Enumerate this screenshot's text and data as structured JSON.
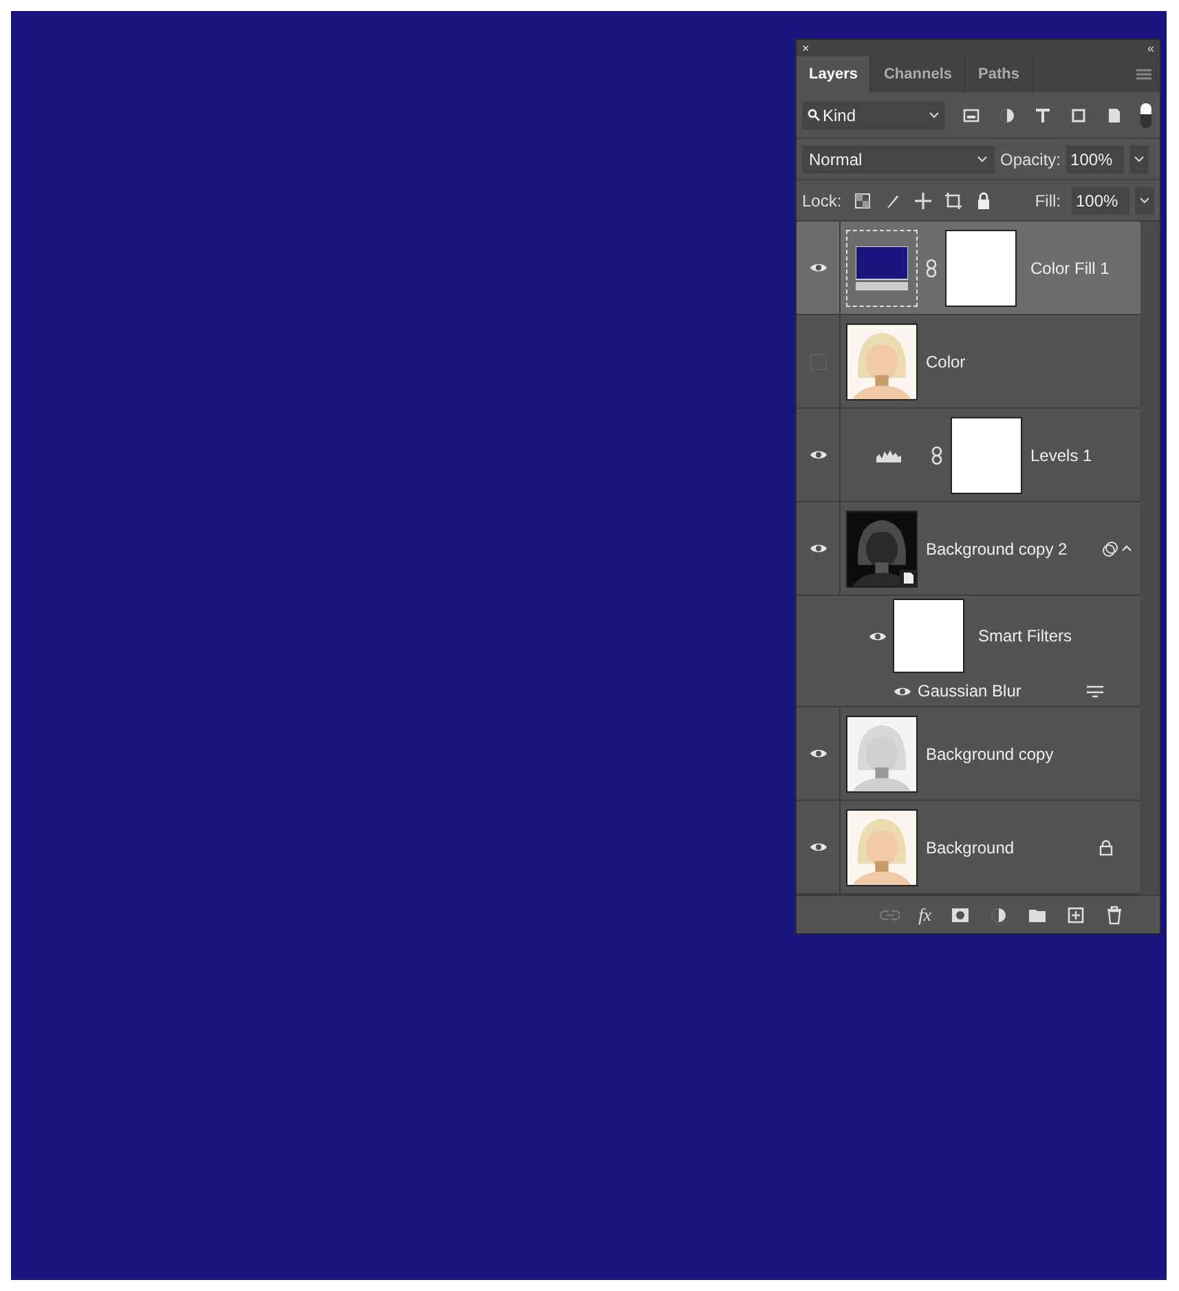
{
  "panel": {
    "close": "×",
    "collapse": "«"
  },
  "tabs": [
    {
      "label": "Layers",
      "selected": true
    },
    {
      "label": "Channels",
      "selected": false
    },
    {
      "label": "Paths",
      "selected": false
    }
  ],
  "filter": {
    "value": "Kind",
    "on": true
  },
  "blend": {
    "mode": "Normal",
    "opacity_label": "Opacity:",
    "opacity": "100%"
  },
  "lock": {
    "label": "Lock:",
    "fill_label": "Fill:",
    "fill": "100%"
  },
  "layers": [
    {
      "kind": "fill",
      "name": "Color Fill 1",
      "visible": true,
      "selected": true
    },
    {
      "kind": "pixel",
      "name": "Color",
      "visible": false,
      "selected": false
    },
    {
      "kind": "adjustment",
      "name": "Levels 1",
      "visible": true,
      "selected": false
    },
    {
      "kind": "smart",
      "name": "Background copy 2",
      "visible": true,
      "selected": false,
      "expanded": true,
      "smart_filters": {
        "label": "Smart Filters",
        "visible": true
      },
      "filters": [
        {
          "name": "Gaussian Blur",
          "visible": true
        }
      ]
    },
    {
      "kind": "pixel",
      "name": "Background copy",
      "visible": true,
      "selected": false
    },
    {
      "kind": "pixel",
      "name": "Background",
      "visible": true,
      "selected": false,
      "locked": true
    }
  ],
  "footer": {
    "fx": "fx"
  }
}
